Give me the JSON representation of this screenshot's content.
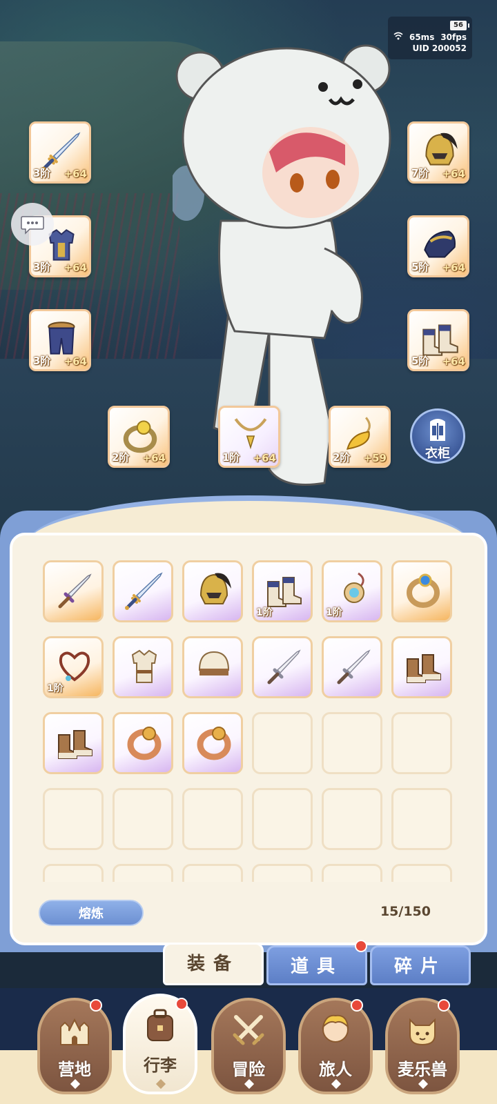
{
  "status": {
    "battery": "56",
    "ping": "65ms",
    "fps": "30fps",
    "uid": "UID 200052"
  },
  "equipped": {
    "left": [
      {
        "name": "sword",
        "tier": "3阶",
        "plus": "+64"
      },
      {
        "name": "armor",
        "tier": "3阶",
        "plus": "+64"
      },
      {
        "name": "pants",
        "tier": "3阶",
        "plus": "+64"
      }
    ],
    "right": [
      {
        "name": "helmet",
        "tier": "7阶",
        "plus": "+64"
      },
      {
        "name": "gauntlet",
        "tier": "5阶",
        "plus": "+64"
      },
      {
        "name": "boots",
        "tier": "5阶",
        "plus": "+64"
      }
    ],
    "bottom": [
      {
        "name": "ring",
        "tier": "2阶",
        "plus": "+64"
      },
      {
        "name": "necklace",
        "tier": "1阶",
        "plus": "+64"
      },
      {
        "name": "charm",
        "tier": "2阶",
        "plus": "+59"
      }
    ]
  },
  "wardrobe": {
    "label": "衣柜"
  },
  "bag": {
    "items": [
      {
        "icon": "dagger-icon",
        "rarity": "orange",
        "tier": ""
      },
      {
        "icon": "sword-icon",
        "rarity": "purple",
        "tier": ""
      },
      {
        "icon": "helmet-icon",
        "rarity": "purple",
        "tier": ""
      },
      {
        "icon": "boots-icon",
        "rarity": "purple",
        "tier": "1阶"
      },
      {
        "icon": "amulet-icon",
        "rarity": "purple",
        "tier": "1阶"
      },
      {
        "icon": "ring-icon",
        "rarity": "orange",
        "tier": ""
      },
      {
        "icon": "necklace-icon",
        "rarity": "orange",
        "tier": "1阶"
      },
      {
        "icon": "tunic-icon",
        "rarity": "purple",
        "tier": ""
      },
      {
        "icon": "cap-icon",
        "rarity": "purple",
        "tier": ""
      },
      {
        "icon": "short-sword-icon",
        "rarity": "purple",
        "tier": ""
      },
      {
        "icon": "short-sword-icon",
        "rarity": "purple",
        "tier": ""
      },
      {
        "icon": "brown-boots-icon",
        "rarity": "purple",
        "tier": ""
      },
      {
        "icon": "brown-boots-icon",
        "rarity": "purple",
        "tier": ""
      },
      {
        "icon": "bronze-ring-icon",
        "rarity": "purple",
        "tier": ""
      },
      {
        "icon": "bronze-ring-icon",
        "rarity": "purple",
        "tier": ""
      }
    ],
    "smelt_label": "熔炼",
    "capacity": "15/150"
  },
  "tabs": [
    {
      "label": "装备",
      "active": true
    },
    {
      "label": "道具",
      "active": false,
      "badge": true
    },
    {
      "label": "碎片",
      "active": false
    }
  ],
  "nav": [
    {
      "label": "营地",
      "icon": "castle-icon",
      "badge": true
    },
    {
      "label": "行李",
      "icon": "backpack-icon",
      "badge": true,
      "active": true
    },
    {
      "label": "冒险",
      "icon": "crossed-swords-icon",
      "badge": false
    },
    {
      "label": "旅人",
      "icon": "traveler-icon",
      "badge": true
    },
    {
      "label": "麦乐兽",
      "icon": "pet-icon",
      "badge": true
    }
  ],
  "colors": {
    "panel_blue": "#7f9fd6",
    "parchment": "#f8f2e4",
    "badge_red": "#e8493a",
    "rarity_purple": "#d7b6f0",
    "rarity_orange": "#f6b660"
  }
}
